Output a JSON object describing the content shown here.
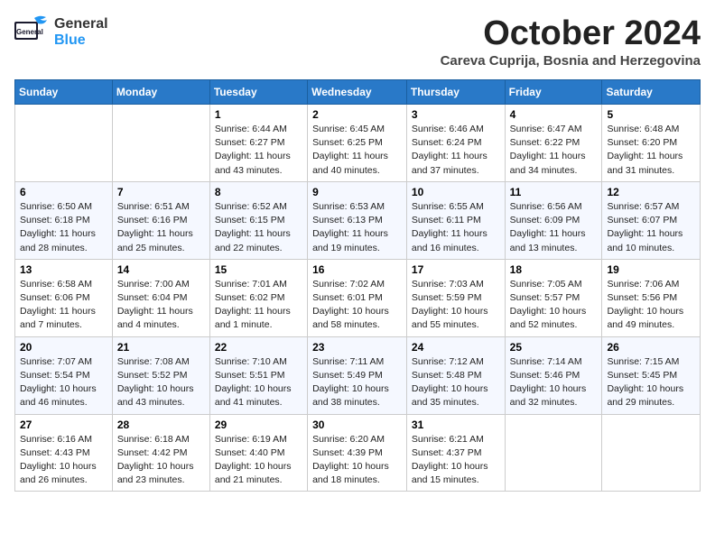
{
  "header": {
    "logo": {
      "general": "General",
      "blue": "Blue"
    },
    "month": "October 2024",
    "location": "Careva Cuprija, Bosnia and Herzegovina"
  },
  "weekdays": [
    "Sunday",
    "Monday",
    "Tuesday",
    "Wednesday",
    "Thursday",
    "Friday",
    "Saturday"
  ],
  "weeks": [
    [
      {
        "day": "",
        "sunrise": "",
        "sunset": "",
        "daylight": ""
      },
      {
        "day": "",
        "sunrise": "",
        "sunset": "",
        "daylight": ""
      },
      {
        "day": "1",
        "sunrise": "Sunrise: 6:44 AM",
        "sunset": "Sunset: 6:27 PM",
        "daylight": "Daylight: 11 hours and 43 minutes."
      },
      {
        "day": "2",
        "sunrise": "Sunrise: 6:45 AM",
        "sunset": "Sunset: 6:25 PM",
        "daylight": "Daylight: 11 hours and 40 minutes."
      },
      {
        "day": "3",
        "sunrise": "Sunrise: 6:46 AM",
        "sunset": "Sunset: 6:24 PM",
        "daylight": "Daylight: 11 hours and 37 minutes."
      },
      {
        "day": "4",
        "sunrise": "Sunrise: 6:47 AM",
        "sunset": "Sunset: 6:22 PM",
        "daylight": "Daylight: 11 hours and 34 minutes."
      },
      {
        "day": "5",
        "sunrise": "Sunrise: 6:48 AM",
        "sunset": "Sunset: 6:20 PM",
        "daylight": "Daylight: 11 hours and 31 minutes."
      }
    ],
    [
      {
        "day": "6",
        "sunrise": "Sunrise: 6:50 AM",
        "sunset": "Sunset: 6:18 PM",
        "daylight": "Daylight: 11 hours and 28 minutes."
      },
      {
        "day": "7",
        "sunrise": "Sunrise: 6:51 AM",
        "sunset": "Sunset: 6:16 PM",
        "daylight": "Daylight: 11 hours and 25 minutes."
      },
      {
        "day": "8",
        "sunrise": "Sunrise: 6:52 AM",
        "sunset": "Sunset: 6:15 PM",
        "daylight": "Daylight: 11 hours and 22 minutes."
      },
      {
        "day": "9",
        "sunrise": "Sunrise: 6:53 AM",
        "sunset": "Sunset: 6:13 PM",
        "daylight": "Daylight: 11 hours and 19 minutes."
      },
      {
        "day": "10",
        "sunrise": "Sunrise: 6:55 AM",
        "sunset": "Sunset: 6:11 PM",
        "daylight": "Daylight: 11 hours and 16 minutes."
      },
      {
        "day": "11",
        "sunrise": "Sunrise: 6:56 AM",
        "sunset": "Sunset: 6:09 PM",
        "daylight": "Daylight: 11 hours and 13 minutes."
      },
      {
        "day": "12",
        "sunrise": "Sunrise: 6:57 AM",
        "sunset": "Sunset: 6:07 PM",
        "daylight": "Daylight: 11 hours and 10 minutes."
      }
    ],
    [
      {
        "day": "13",
        "sunrise": "Sunrise: 6:58 AM",
        "sunset": "Sunset: 6:06 PM",
        "daylight": "Daylight: 11 hours and 7 minutes."
      },
      {
        "day": "14",
        "sunrise": "Sunrise: 7:00 AM",
        "sunset": "Sunset: 6:04 PM",
        "daylight": "Daylight: 11 hours and 4 minutes."
      },
      {
        "day": "15",
        "sunrise": "Sunrise: 7:01 AM",
        "sunset": "Sunset: 6:02 PM",
        "daylight": "Daylight: 11 hours and 1 minute."
      },
      {
        "day": "16",
        "sunrise": "Sunrise: 7:02 AM",
        "sunset": "Sunset: 6:01 PM",
        "daylight": "Daylight: 10 hours and 58 minutes."
      },
      {
        "day": "17",
        "sunrise": "Sunrise: 7:03 AM",
        "sunset": "Sunset: 5:59 PM",
        "daylight": "Daylight: 10 hours and 55 minutes."
      },
      {
        "day": "18",
        "sunrise": "Sunrise: 7:05 AM",
        "sunset": "Sunset: 5:57 PM",
        "daylight": "Daylight: 10 hours and 52 minutes."
      },
      {
        "day": "19",
        "sunrise": "Sunrise: 7:06 AM",
        "sunset": "Sunset: 5:56 PM",
        "daylight": "Daylight: 10 hours and 49 minutes."
      }
    ],
    [
      {
        "day": "20",
        "sunrise": "Sunrise: 7:07 AM",
        "sunset": "Sunset: 5:54 PM",
        "daylight": "Daylight: 10 hours and 46 minutes."
      },
      {
        "day": "21",
        "sunrise": "Sunrise: 7:08 AM",
        "sunset": "Sunset: 5:52 PM",
        "daylight": "Daylight: 10 hours and 43 minutes."
      },
      {
        "day": "22",
        "sunrise": "Sunrise: 7:10 AM",
        "sunset": "Sunset: 5:51 PM",
        "daylight": "Daylight: 10 hours and 41 minutes."
      },
      {
        "day": "23",
        "sunrise": "Sunrise: 7:11 AM",
        "sunset": "Sunset: 5:49 PM",
        "daylight": "Daylight: 10 hours and 38 minutes."
      },
      {
        "day": "24",
        "sunrise": "Sunrise: 7:12 AM",
        "sunset": "Sunset: 5:48 PM",
        "daylight": "Daylight: 10 hours and 35 minutes."
      },
      {
        "day": "25",
        "sunrise": "Sunrise: 7:14 AM",
        "sunset": "Sunset: 5:46 PM",
        "daylight": "Daylight: 10 hours and 32 minutes."
      },
      {
        "day": "26",
        "sunrise": "Sunrise: 7:15 AM",
        "sunset": "Sunset: 5:45 PM",
        "daylight": "Daylight: 10 hours and 29 minutes."
      }
    ],
    [
      {
        "day": "27",
        "sunrise": "Sunrise: 6:16 AM",
        "sunset": "Sunset: 4:43 PM",
        "daylight": "Daylight: 10 hours and 26 minutes."
      },
      {
        "day": "28",
        "sunrise": "Sunrise: 6:18 AM",
        "sunset": "Sunset: 4:42 PM",
        "daylight": "Daylight: 10 hours and 23 minutes."
      },
      {
        "day": "29",
        "sunrise": "Sunrise: 6:19 AM",
        "sunset": "Sunset: 4:40 PM",
        "daylight": "Daylight: 10 hours and 21 minutes."
      },
      {
        "day": "30",
        "sunrise": "Sunrise: 6:20 AM",
        "sunset": "Sunset: 4:39 PM",
        "daylight": "Daylight: 10 hours and 18 minutes."
      },
      {
        "day": "31",
        "sunrise": "Sunrise: 6:21 AM",
        "sunset": "Sunset: 4:37 PM",
        "daylight": "Daylight: 10 hours and 15 minutes."
      },
      {
        "day": "",
        "sunrise": "",
        "sunset": "",
        "daylight": ""
      },
      {
        "day": "",
        "sunrise": "",
        "sunset": "",
        "daylight": ""
      }
    ]
  ]
}
